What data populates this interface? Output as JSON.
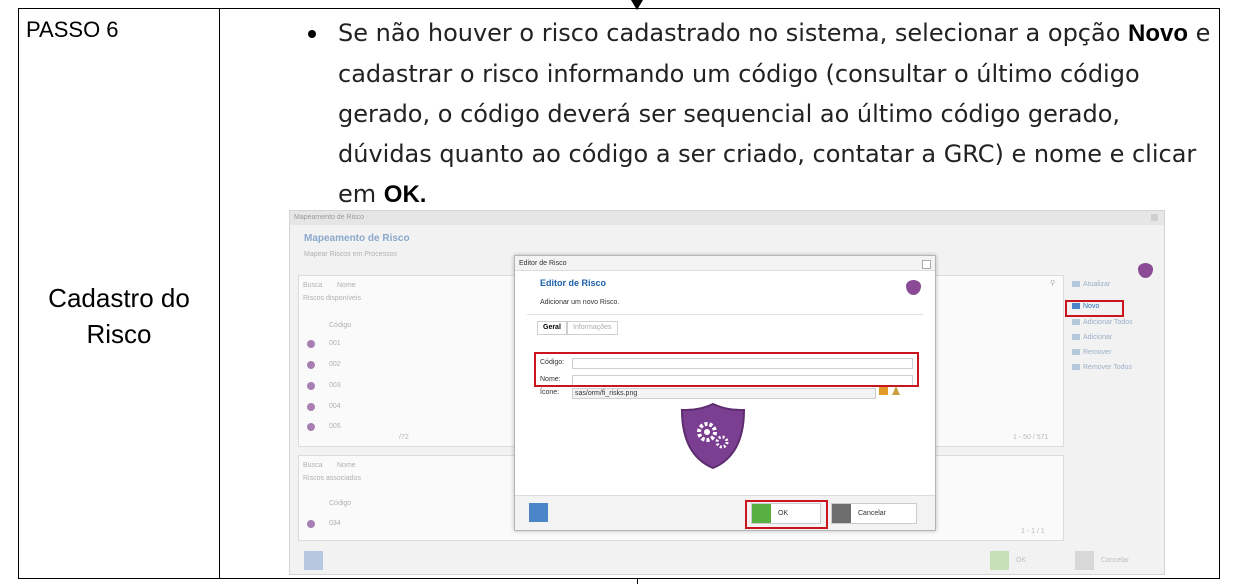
{
  "step_label": "PASSO 6",
  "section_title_line1": "Cadastro do",
  "section_title_line2": "Risco",
  "instruction": {
    "p1": "Se não houver o risco cadastrado no sistema, selecionar a opção ",
    "b1": "Novo",
    "p2": " e cadastrar o risco informando um código (consultar o último código gerado, o código deverá ser sequencial ao último código gerado, dúvidas quanto ao código a ser criado, contatar a GRC) e nome e clicar em ",
    "b2": "OK."
  },
  "screenshot": {
    "window_title": "Mapeamento de Risco",
    "title": "Mapeamento de Risco",
    "subtitle": "Mapear Riscos em Processos",
    "search_label": "Busca",
    "search_field": "Nome",
    "available_label": "Riscos disponíveis",
    "col_code": "Código",
    "codes": [
      "001",
      "002",
      "003",
      "004",
      "005"
    ],
    "pager_top": "/72",
    "range_top": "1 - 50 / 571",
    "associated_label": "Riscos associados",
    "assoc_codes": [
      "034"
    ],
    "range_bottom": "1 - 1 / 1",
    "side_buttons": [
      "Atualizar",
      "Novo",
      "Adicionar Todos",
      "Adicionar",
      "Remover",
      "Remover Todos"
    ],
    "ok_label": "OK",
    "cancel_label": "Cancelar"
  },
  "dialog": {
    "window_title": "Editor de Risco",
    "title": "Editor de Risco",
    "subtitle": "Adicionar um novo Risco.",
    "tabs": [
      "Geral",
      "Informações"
    ],
    "code_label": "Código:",
    "name_label": "Nome:",
    "icon_label": "Ícone:",
    "icon_value": "sas/orm/fi_risks.png",
    "ok_label": "OK",
    "cancel_label": "Cancelar"
  },
  "colors": {
    "highlight": "#c9151e",
    "shield": "#7b3f91",
    "title_blue": "#1a5fa8"
  }
}
